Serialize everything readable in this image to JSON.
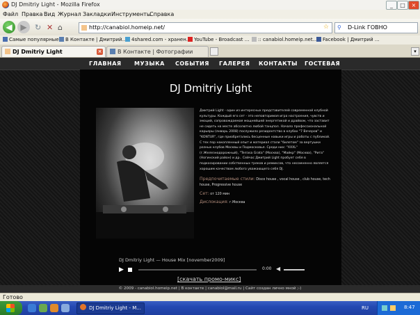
{
  "window": {
    "title": "DJ Dmitriy Light - Mozilla Firefox"
  },
  "menu": [
    "Файл",
    "Правка",
    "Вид",
    "Журнал",
    "Закладки",
    "Инструменты",
    "Справка"
  ],
  "address": {
    "url": "http://canabiol.homeip.net/"
  },
  "search": {
    "value": "D-Link ГОВНО"
  },
  "bookmarks": [
    "Самые популярные",
    "В Контакте | Дмитрий...",
    "4shared.com - хранен...",
    "YouTube - Broadcast ...",
    ":: canabiol.homeip.net...",
    "Facebook | Дмитрий ..."
  ],
  "tabs": [
    {
      "label": "DJ Dmitriy Light"
    },
    {
      "label": "В Контакте | Фотографии"
    }
  ],
  "site_nav": [
    "ГЛАВНАЯ",
    "МУЗЫКА",
    "СОБЫТИЯ",
    "ГАЛЕРЕЯ",
    "КОНТАКТЫ",
    "ГОСТЕВАЯ"
  ],
  "site": {
    "title": "DJ Dmitriy Light",
    "bio": "Дмитрий Light - один из интересных представителей современной клубной культуры. Каждый его сет - это неповторимая игра настроения, чувств и эмоций, сопровождаемая мощнейшей энергетикой и драйвом, что заставит не сидеть на месте абсолютно любой танцпол. Начало профессиональной карьеры (январь 2008) послужило резидентство в клубах \"7 Вечеров\" и \"KONTUR\", где приобретались бесценные навыки игры и работы с публикой. С тех пор накопленный опыт и материал стали \"билетом\" за вертушки разных клубов Москвы и Подмосковья. Среди них: \"XXXL\" (г.Железнодорожный), \"Terrasa Grata\" (Москва), \"Майкр\" (Москва), \"Рита\" (Ногинский район) и др.. Сейчас Дмитрий Light пробует себя в подкосировании собственных треков и ремиксов, что несомненно является хорошим качеством любого уважающего себя DJ.",
    "styles_label": "Предпочитаемые стили:",
    "styles": "Disco house , vocal house , club house, tech house, Progressive house",
    "set_label": "Сет:",
    "set": "от 120 мин",
    "location_label": "Дислокация:",
    "location": "г.Москва",
    "track": "DJ Dmitriy Light — House Mix [november2009]",
    "time": "0:00",
    "download": "[скачать промо-микс]",
    "footer": "© 2009 - canabiol.homeip.net | В контакте | canabiol@mail.ru | Сайт создан личнo мной ;-)"
  },
  "status": "Готово",
  "taskbar": {
    "task": "DJ Dmitriy Light - M...",
    "lang": "RU",
    "clock": "8:47"
  },
  "colors": {
    "accent_label": "#b08a7a",
    "page_bg": "#161616"
  }
}
